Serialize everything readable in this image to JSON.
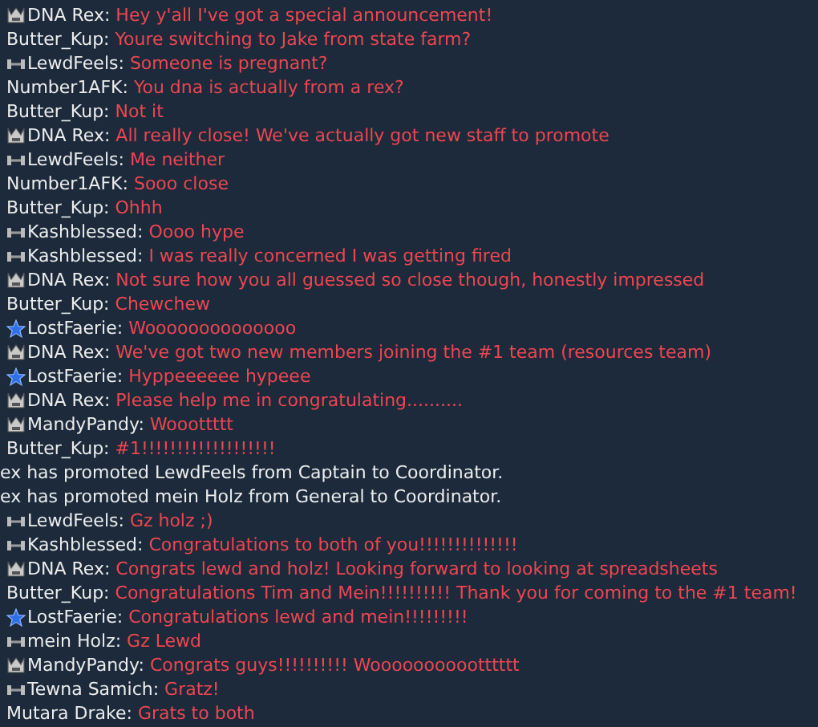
{
  "messages": [
    {
      "kind": "crown",
      "name": "DNA Rex:",
      "text": "Hey y'all I've got a special announcement!"
    },
    {
      "kind": "plain",
      "name": "Butter_Kup:",
      "text": "Youre switching to Jake from state farm?"
    },
    {
      "kind": "dumbbell",
      "name": "LewdFeels:",
      "text": "Someone is pregnant?"
    },
    {
      "kind": "plain",
      "name": "Number1AFK:",
      "text": "You dna is actually from a rex?"
    },
    {
      "kind": "plain",
      "name": "Butter_Kup:",
      "text": "Not it"
    },
    {
      "kind": "crown",
      "name": "DNA Rex:",
      "text": "All really close! We've actually got new staff to promote"
    },
    {
      "kind": "dumbbell",
      "name": "LewdFeels:",
      "text": "Me neither"
    },
    {
      "kind": "plain",
      "name": "Number1AFK:",
      "text": "Sooo close"
    },
    {
      "kind": "plain",
      "name": "Butter_Kup:",
      "text": "Ohhh"
    },
    {
      "kind": "dumbbell",
      "name": "Kashblessed:",
      "text": "Oooo hype"
    },
    {
      "kind": "dumbbell",
      "name": "Kashblessed:",
      "text": "I was really concerned I was getting fired"
    },
    {
      "kind": "crown",
      "name": "DNA Rex:",
      "text": "Not sure how you all guessed so close though, honestly impressed"
    },
    {
      "kind": "plain",
      "name": "Butter_Kup:",
      "text": "Chewchew"
    },
    {
      "kind": "star",
      "name": "LostFaerie:",
      "text": "Woooooooooooooo"
    },
    {
      "kind": "crown",
      "name": "DNA Rex:",
      "text": "We've got two new members joining the #1 team (resources team)"
    },
    {
      "kind": "star",
      "name": "LostFaerie:",
      "text": "Hyppeeeeee hypeee"
    },
    {
      "kind": "crown",
      "name": "DNA Rex:",
      "text": "Please help me in congratulating.........."
    },
    {
      "kind": "crown",
      "name": "MandyPandy:",
      "text": "Wooottttt"
    },
    {
      "kind": "plain",
      "name": "Butter_Kup:",
      "text": "#1!!!!!!!!!!!!!!!!!!!"
    },
    {
      "kind": "system",
      "text": "ex has promoted LewdFeels from Captain to Coordinator."
    },
    {
      "kind": "system",
      "text": "ex has promoted mein Holz from General to Coordinator."
    },
    {
      "kind": "dumbbell",
      "name": "LewdFeels:",
      "text": "Gz holz ;)"
    },
    {
      "kind": "dumbbell",
      "name": "Kashblessed:",
      "text": "Congratulations to both of you!!!!!!!!!!!!!!"
    },
    {
      "kind": "crown",
      "name": "DNA Rex:",
      "text": "Congrats lewd and holz! Looking forward to looking at spreadsheets"
    },
    {
      "kind": "plain",
      "name": "Butter_Kup:",
      "text": "Congratulations Tim and Mein!!!!!!!!!! Thank you for coming to the #1 team!"
    },
    {
      "kind": "star",
      "name": "LostFaerie:",
      "text": "Congratulations lewd and mein!!!!!!!!!"
    },
    {
      "kind": "dumbbell",
      "name": "mein Holz:",
      "text": "Gz Lewd"
    },
    {
      "kind": "crown",
      "name": "MandyPandy:",
      "text": "Congrats guys!!!!!!!!!! Wooooooooootttttt"
    },
    {
      "kind": "dumbbell",
      "name": "Tewna Samich:",
      "text": "Gratz!"
    },
    {
      "kind": "plain",
      "name": "Mutara Drake:",
      "text": "Grats to both"
    }
  ]
}
